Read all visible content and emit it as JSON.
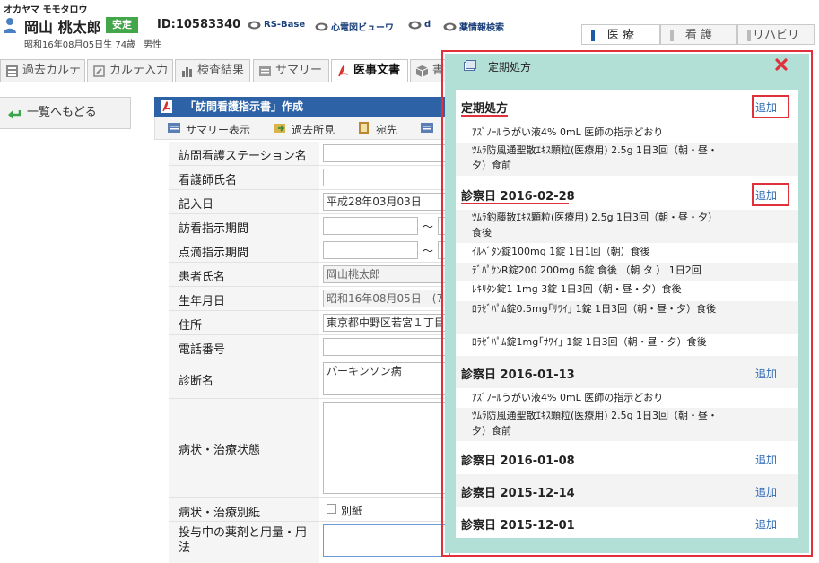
{
  "header": {
    "patient_kana": "オカヤマ モモタロウ",
    "patient_name": "岡山 桃太郎",
    "status_badge": "安定",
    "patient_id": "ID:10583340",
    "links": [
      "RS-Base",
      "心電図ビューワ",
      "d",
      "薬情報検索"
    ],
    "birth_age": "昭和16年08月05日生 74歳",
    "sex": "男性",
    "dept_tabs": [
      "医 療",
      "看 護",
      "リハビリ"
    ]
  },
  "nav_tabs": [
    "過去カルテ",
    "カルテ入力",
    "検査結果",
    "サマリー",
    "医事文書",
    "書"
  ],
  "back_button": "一覧へもどる",
  "form": {
    "title": "「訪問看護指示書」作成",
    "toolbar": [
      "サマリー表示",
      "過去所見",
      "宛先",
      ""
    ],
    "rows": [
      {
        "label": "訪問看護ステーション名",
        "value": ""
      },
      {
        "label": "看護師氏名",
        "value": ""
      },
      {
        "label": "記入日",
        "value": "平成28年03月03日"
      },
      {
        "label": "訪看指示期間",
        "value": "",
        "sep": "～"
      },
      {
        "label": "点滴指示期間",
        "value": "",
        "sep": "～"
      },
      {
        "label": "患者氏名",
        "value": "岡山桃太郎"
      },
      {
        "label": "生年月日",
        "value": "昭和16年08月05日　(7"
      },
      {
        "label": "住所",
        "value": "東京都中野区若宮１丁目"
      },
      {
        "label": "電話番号",
        "value": ""
      },
      {
        "label": "診断名",
        "value": "パーキンソン病"
      },
      {
        "label": "病状・治療状態",
        "value": ""
      },
      {
        "label": "病状・治療別紙",
        "checkbox_label": "別紙"
      },
      {
        "label": "投与中の薬剤と用量・用法",
        "value": ""
      }
    ]
  },
  "modal": {
    "title": "定期処方",
    "add_label": "追加",
    "sections": [
      {
        "title": "定期処方",
        "items": [
          "ｱｽﾞﾉｰﾙうがい液4% 0mL 医師の指示どおり",
          "ﾂﾑﾗ防風通聖散ｴｷｽ顆粒(医療用) 2.5g 1日3回（朝・昼・夕）食前"
        ]
      },
      {
        "title": "診察日 2016-02-28",
        "items": [
          "ﾂﾑﾗ釣藤散ｴｷｽ顆粒(医療用) 2.5g 1日3回（朝・昼・夕）食後",
          "ｲﾙﾍﾞﾀﾝ錠100mg 1錠 1日1回（朝）食後",
          "ﾃﾞﾊﾟｹﾝR錠200 200mg 6錠 食後 （朝 タ ） 1日2回",
          "ﾚｷﾘﾀﾝ錠1 1mg 3錠 1日3回（朝・昼・夕）食後",
          "ﾛﾗｾﾞﾊﾟﾑ錠0.5mg｢ｻﾜｲ｣ 1錠 1日3回（朝・昼・夕）食後",
          "ﾛﾗｾﾞﾊﾟﾑ錠1mg｢ｻﾜｲ｣ 1錠 1日3回（朝・昼・夕）食後"
        ]
      },
      {
        "title": "診察日 2016-01-13",
        "items": [
          "ｱｽﾞﾉｰﾙうがい液4% 0mL 医師の指示どおり",
          "ﾂﾑﾗ防風通聖散ｴｷｽ顆粒(医療用) 2.5g 1日3回（朝・昼・夕）食前"
        ]
      },
      {
        "title": "診察日 2016-01-08",
        "items": []
      },
      {
        "title": "診察日 2015-12-14",
        "items": []
      },
      {
        "title": "診察日 2015-12-01",
        "items": []
      }
    ]
  }
}
